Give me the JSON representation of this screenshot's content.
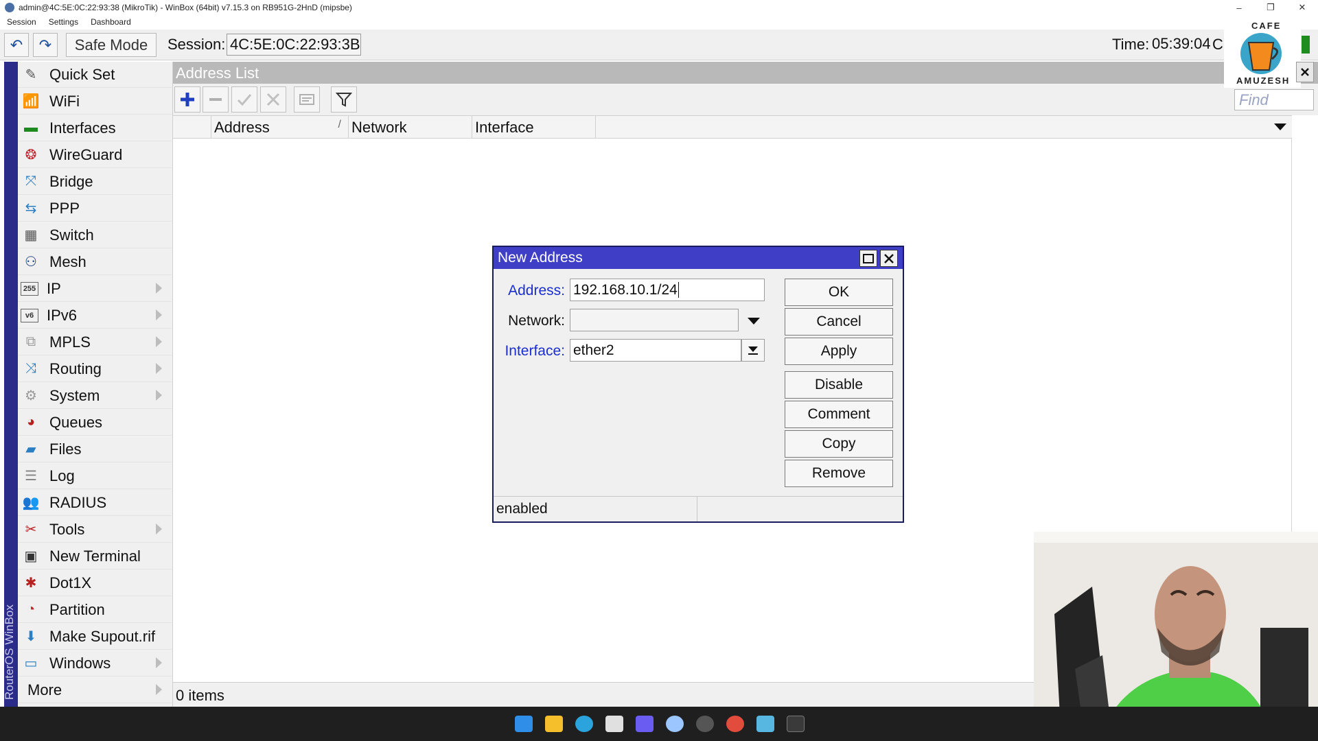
{
  "window": {
    "title": "admin@4C:5E:0C:22:93:38 (MikroTik) - WinBox (64bit) v7.15.3 on RB951G-2HnD (mipsbe)",
    "controls": [
      "–",
      "❐",
      "✕"
    ]
  },
  "menubar": [
    "Session",
    "Settings",
    "Dashboard"
  ],
  "toolbar": {
    "undo_icon": "↶",
    "redo_icon": "↷",
    "safe_mode": "Safe Mode",
    "session_label": "Session:",
    "session_value": "4C:5E:0C:22:93:3B",
    "time_label": "Time:",
    "time_value": "05:39:04",
    "time_extra": "C"
  },
  "sidebar": {
    "brand": "RouterOS WinBox",
    "items": [
      {
        "label": "Quick Set",
        "icon": "✎",
        "color": "#555"
      },
      {
        "label": "WiFi",
        "icon": "📶",
        "color": "#666"
      },
      {
        "label": "Interfaces",
        "icon": "▬",
        "color": "#1c8a1c"
      },
      {
        "label": "WireGuard",
        "icon": "❂",
        "color": "#c0282d"
      },
      {
        "label": "Bridge",
        "icon": "⤧",
        "color": "#2c7ec4"
      },
      {
        "label": "PPP",
        "icon": "⇆",
        "color": "#2c7ec4"
      },
      {
        "label": "Switch",
        "icon": "▦",
        "color": "#555"
      },
      {
        "label": "Mesh",
        "icon": "⚇",
        "color": "#1c3f7a"
      },
      {
        "label": "IP",
        "icon": "255",
        "color": "#333"
      },
      {
        "label": "IPv6",
        "icon": "v6",
        "color": "#333"
      },
      {
        "label": "MPLS",
        "icon": "⧉",
        "color": "#999"
      },
      {
        "label": "Routing",
        "icon": "⤨",
        "color": "#2c7ec4"
      },
      {
        "label": "System",
        "icon": "⚙",
        "color": "#999"
      },
      {
        "label": "Queues",
        "icon": "◕",
        "color": "#b82020"
      },
      {
        "label": "Files",
        "icon": "▰",
        "color": "#2c7ec4"
      },
      {
        "label": "Log",
        "icon": "☰",
        "color": "#888"
      },
      {
        "label": "RADIUS",
        "icon": "👥",
        "color": "#2c7ec4"
      },
      {
        "label": "Tools",
        "icon": "✂",
        "color": "#b82020"
      },
      {
        "label": "New Terminal",
        "icon": "▣",
        "color": "#333"
      },
      {
        "label": "Dot1X",
        "icon": "✱",
        "color": "#b82020"
      },
      {
        "label": "Partition",
        "icon": "◔",
        "color": "#c0282d"
      },
      {
        "label": "Make Supout.rif",
        "icon": "⬇",
        "color": "#2c7ec4"
      },
      {
        "label": "Windows",
        "icon": "▭",
        "color": "#2c7ec4"
      },
      {
        "label": "More",
        "icon": "",
        "color": "#333"
      }
    ]
  },
  "address_list": {
    "title": "Address List",
    "columns": [
      "",
      "Address",
      "Network",
      "Interface"
    ],
    "sort_indicator": "/",
    "status": "0 items",
    "find_placeholder": "Find"
  },
  "dialog": {
    "title": "New Address",
    "address_label": "Address:",
    "address_value": "192.168.10.1/24",
    "network_label": "Network:",
    "network_value": "",
    "interface_label": "Interface:",
    "interface_value": "ether2",
    "buttons": [
      "OK",
      "Cancel",
      "Apply",
      "Disable",
      "Comment",
      "Copy",
      "Remove"
    ],
    "status": "enabled"
  },
  "logo": {
    "top_text": "CAFE",
    "bottom_text": "AMUZESH"
  }
}
